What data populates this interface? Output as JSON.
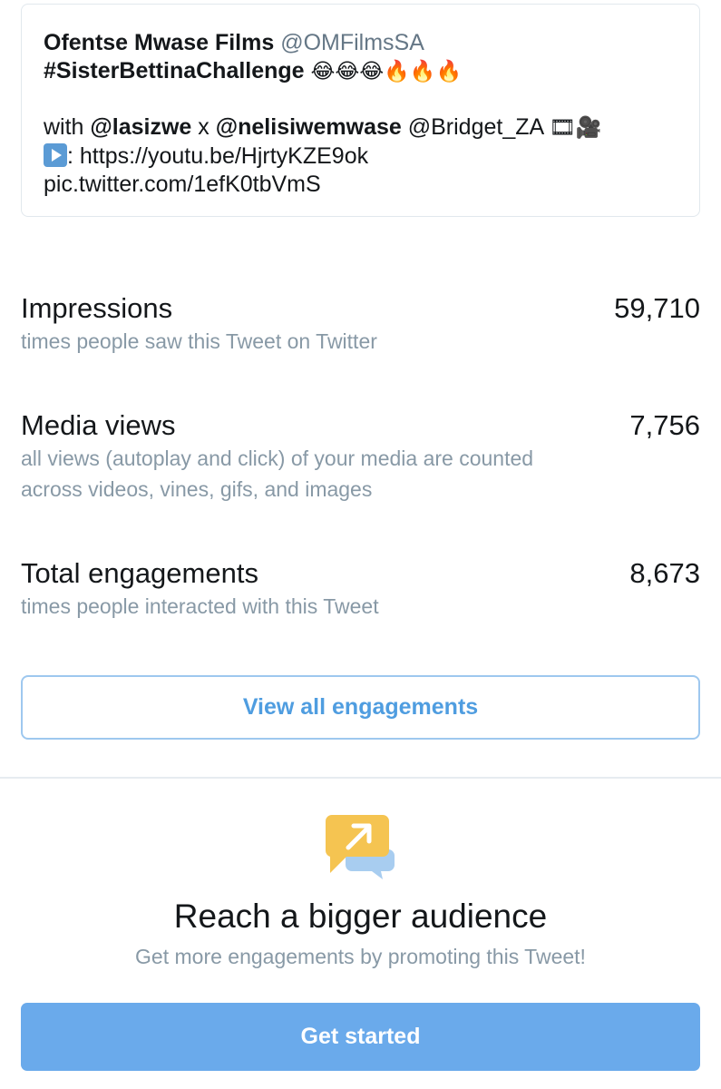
{
  "tweet": {
    "author_name": "Ofentse Mwase Films",
    "author_handle": "@OMFilmsSA",
    "hashtag": "#SisterBettinaChallenge",
    "hashtag_emojis": "😂😂😂🔥🔥🔥",
    "with_prefix": "with ",
    "mention1": "@lasizwe",
    "separator": " x ",
    "mention2": "@nelisiwemwase",
    "mention3": " @Bridget_ZA ",
    "mention_emojis": "🎞🎥",
    "link_prefix": ": ",
    "youtube_link": "https://youtu.be/HjrtyKZE9ok",
    "pic_link": "pic.twitter.com/1efK0tbVmS"
  },
  "metrics": [
    {
      "title": "Impressions",
      "value": "59,710",
      "description": "times people saw this Tweet on Twitter"
    },
    {
      "title": "Media views",
      "value": "7,756",
      "description_line1": "all views (autoplay and click) of your media are counted",
      "description_line2": "across videos, vines, gifs, and images"
    },
    {
      "title": "Total engagements",
      "value": "8,673",
      "description": "times people interacted with this Tweet"
    }
  ],
  "engagements_button": "View all engagements",
  "promo": {
    "icon": "promote-speech-bubble-arrow-icon",
    "title": "Reach a bigger audience",
    "subtitle": "Get more engagements by promoting this Tweet!",
    "button": "Get started"
  },
  "colors": {
    "link_blue": "#4f9de0",
    "primary_button": "#6aaaeb",
    "muted_text": "#8899a6",
    "icon_yellow": "#f5c451",
    "icon_blue": "#a8cdf0"
  }
}
